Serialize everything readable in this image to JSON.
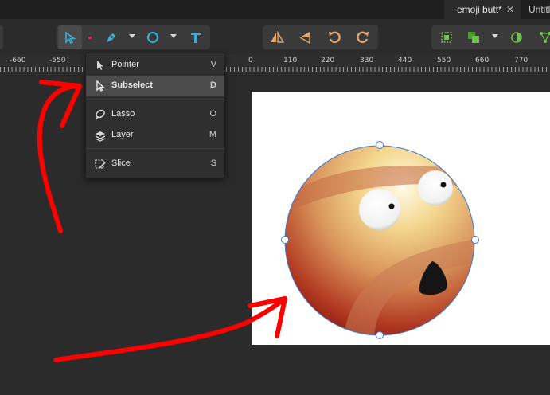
{
  "tabs": [
    {
      "label": "emoji butt*",
      "active": true
    },
    {
      "label": "Untitl",
      "active": false
    }
  ],
  "toolbar": {
    "tools": [
      "pointer-tool",
      "pen-tool",
      "ellipse-tool",
      "text-tool"
    ],
    "transform": [
      "flip-horizontal",
      "flip-vertical",
      "rotate-left",
      "rotate-right"
    ],
    "path_ops": [
      "group-tool",
      "union-tool",
      "mask-tool",
      "symbol-tool"
    ],
    "accent": "#3ab0d6",
    "warm": "#e0a672",
    "green": "#6fc24a"
  },
  "ruler": {
    "labels": [
      "-660",
      "-550",
      "0",
      "110",
      "220",
      "330",
      "440",
      "550",
      "660",
      "770"
    ]
  },
  "menu": {
    "items": [
      {
        "label": "Pointer",
        "shortcut": "V"
      },
      {
        "label": "Subselect",
        "shortcut": "D",
        "highlighted": true
      },
      {
        "label": "Lasso",
        "shortcut": "O"
      },
      {
        "label": "Layer",
        "shortcut": "M"
      },
      {
        "label": "Slice",
        "shortcut": "S"
      }
    ]
  },
  "annotation_color": "#ff0000"
}
